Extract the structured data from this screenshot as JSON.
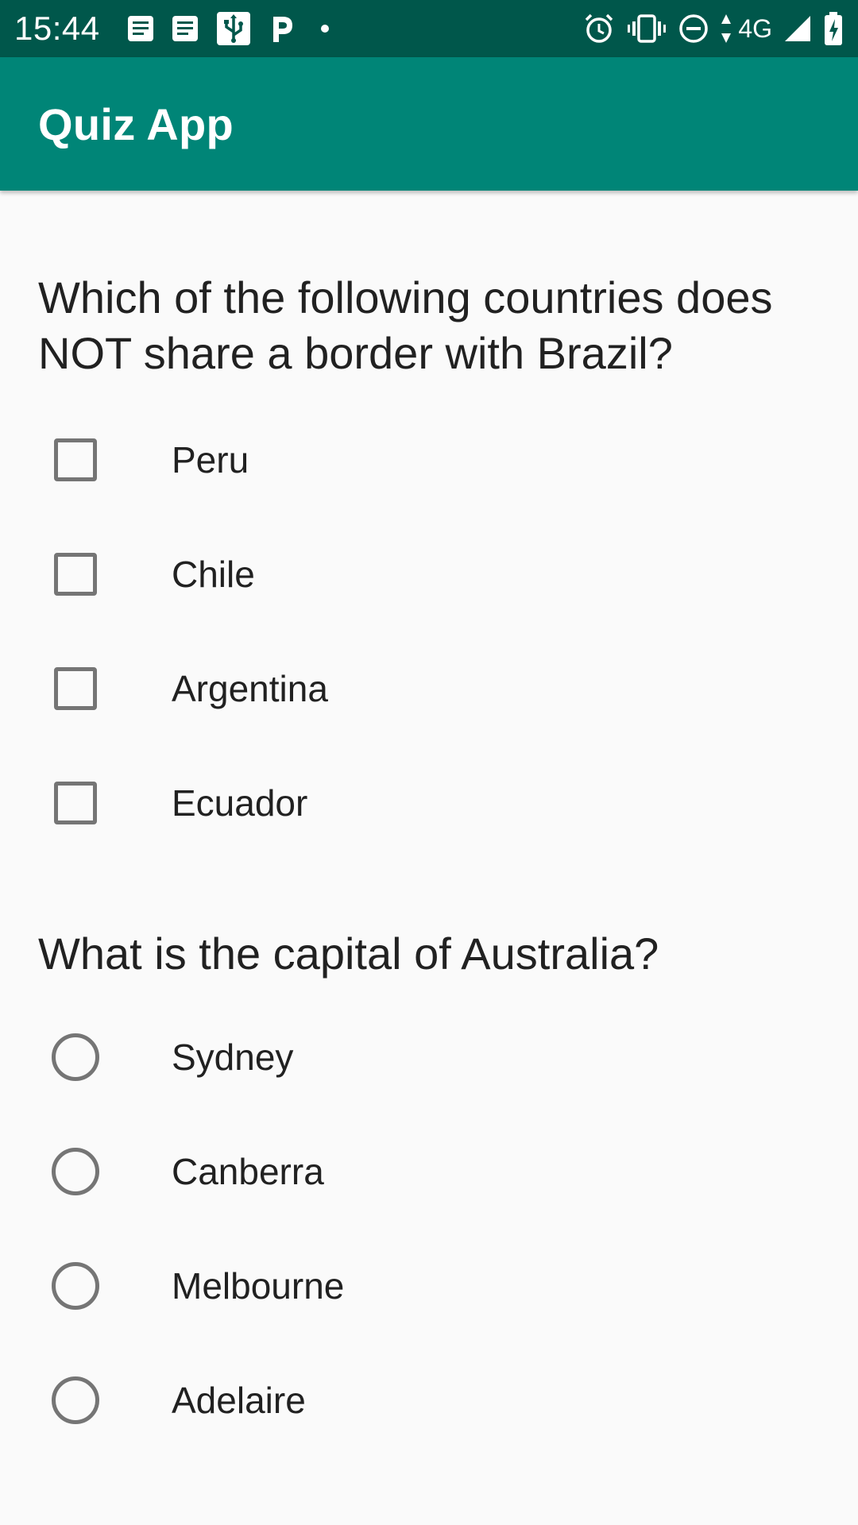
{
  "status_bar": {
    "time": "15:44",
    "network": "4G",
    "left_icons": [
      "notes-icon",
      "notes-icon",
      "usb-icon",
      "parking-icon",
      "dot-icon"
    ],
    "right_icons": [
      "alarm-icon",
      "vibrate-icon",
      "do-not-disturb-icon",
      "data-arrows-icon",
      "signal-icon",
      "battery-charging-icon"
    ]
  },
  "app_bar": {
    "title": "Quiz App",
    "color": "#008577"
  },
  "questions": [
    {
      "text": "Which of the following countries does NOT share a border with Brazil?",
      "type": "checkbox",
      "options": [
        {
          "label": "Peru",
          "checked": false
        },
        {
          "label": "Chile",
          "checked": false
        },
        {
          "label": "Argentina",
          "checked": false
        },
        {
          "label": "Ecuador",
          "checked": false
        }
      ]
    },
    {
      "text": "What is the capital of Australia?",
      "type": "radio",
      "options": [
        {
          "label": "Sydney",
          "checked": false
        },
        {
          "label": "Canberra",
          "checked": false
        },
        {
          "label": "Melbourne",
          "checked": false
        },
        {
          "label": "Adelaire",
          "checked": false
        }
      ]
    }
  ],
  "colors": {
    "status_bar": "#00574b",
    "app_bar": "#008577",
    "background": "#fafafa",
    "text": "#212121",
    "control_border": "#757575"
  }
}
